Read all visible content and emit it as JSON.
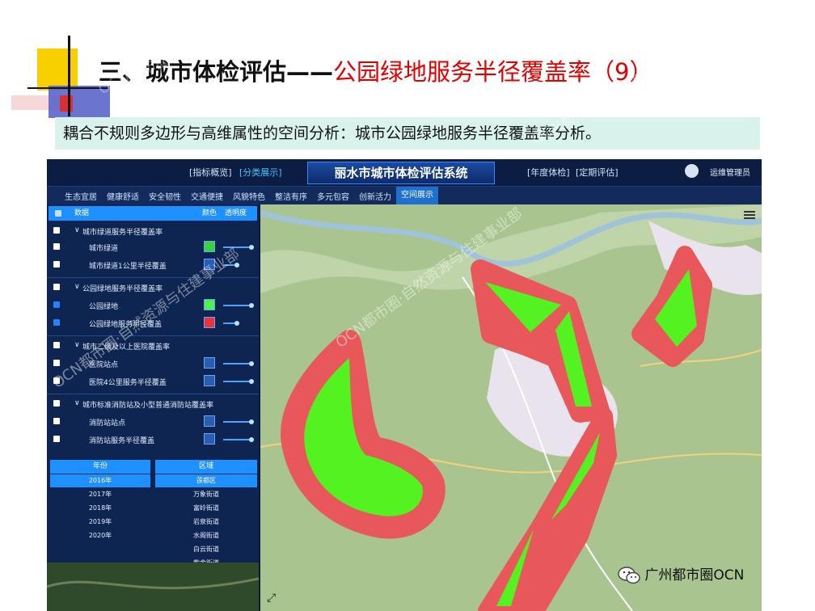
{
  "slide": {
    "title_main": "三、城市体检评估——",
    "title_red": "公园绿地服务半径覆盖率（9）",
    "subtitle": "耦合不规则多边形与高维属性的空间分析：城市公园绿地服务半径覆盖率分析。"
  },
  "app": {
    "title": "丽水市城市体检评估系统",
    "topnav_left": [
      "[指标概览]",
      "[分类展示]"
    ],
    "topnav_right": [
      "[年度体检]",
      "[定期评估]"
    ],
    "active_topnav": "[分类展示]",
    "user": "运维管理员",
    "menu": [
      "生态宜居",
      "健康舒适",
      "安全韧性",
      "交通便捷",
      "风貌特色",
      "整洁有序",
      "多元包容",
      "创新活力",
      "空间展示"
    ],
    "active_menu": "空间展示"
  },
  "panel": {
    "head": {
      "name": "数据",
      "color": "颜色",
      "opacity": "透明度"
    },
    "rows": [
      {
        "label": "城市绿道服务半径覆盖率",
        "type": "group",
        "checked": false
      },
      {
        "label": "城市绿道",
        "type": "layer",
        "checked": false,
        "swatch": "#39d33a"
      },
      {
        "label": "城市绿道1公里半径覆盖",
        "type": "layer",
        "checked": false,
        "swatch": "#2a5fb0"
      },
      {
        "label": "公园绿地服务半径覆盖率",
        "type": "group",
        "checked": false
      },
      {
        "label": "公园绿地",
        "type": "layer",
        "checked": true,
        "swatch": "#4df24d"
      },
      {
        "label": "公园绿地服务半径覆盖",
        "type": "layer",
        "checked": true,
        "swatch": "#e8343a"
      },
      {
        "label": "城市二级及以上医院覆盖率",
        "type": "group",
        "checked": false
      },
      {
        "label": "医院站点",
        "type": "layer",
        "checked": false,
        "swatch": "#2a5fb0"
      },
      {
        "label": "医院4公里服务半径覆盖",
        "type": "layer",
        "checked": false,
        "swatch": "#2a5fb0"
      },
      {
        "label": "城市标准消防站及小型普通消防站覆盖率",
        "type": "group",
        "checked": false
      },
      {
        "label": "消防站站点",
        "type": "layer",
        "checked": false,
        "swatch": "#2a5fb0"
      },
      {
        "label": "消防站服务半径覆盖",
        "type": "layer",
        "checked": false,
        "swatch": "#2a5fb0"
      }
    ],
    "year_head": "年份",
    "years": [
      "2016年",
      "2017年",
      "2018年",
      "2019年",
      "2020年"
    ],
    "selected_year": "2016年",
    "region_head": "区域",
    "regions": [
      "莲都区",
      "万象街道",
      "富岭街道",
      "岩泉街道",
      "水阁街道",
      "白云街道",
      "紫金街道"
    ],
    "selected_region": "莲都区"
  },
  "map_colors": {
    "buffer": "#e8575a",
    "park": "#55f222",
    "base": "#a9c48f"
  },
  "watermark": "OCN都市圈·自然资源与住建事业部",
  "badge": "广州都市圈OCN"
}
